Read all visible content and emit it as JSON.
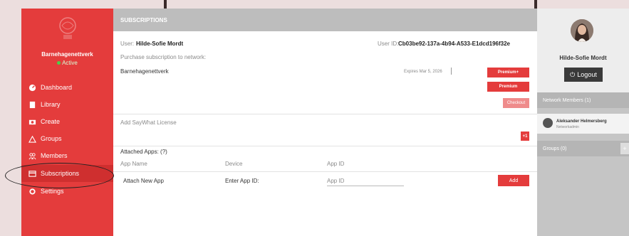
{
  "org": {
    "name": "Barnehagenettverk",
    "status": "Active"
  },
  "nav": [
    {
      "label": "Dashboard",
      "icon": "dashboard-icon"
    },
    {
      "label": "Library",
      "icon": "book-icon"
    },
    {
      "label": "Create",
      "icon": "camera-icon"
    },
    {
      "label": "Groups",
      "icon": "groups-icon"
    },
    {
      "label": "Members",
      "icon": "members-icon"
    },
    {
      "label": "Subscriptions",
      "icon": "card-icon"
    },
    {
      "label": "Settings",
      "icon": "gear-icon"
    }
  ],
  "main": {
    "header": "SUBSCRIPTIONS",
    "user_label": "User:",
    "user_name": "Hilde-Sofie Mordt",
    "user_id_label": "User ID:",
    "user_id": "Cb03be92-137a-4b94-A533-E1dcd196f32e",
    "purchase_label": "Purchase subscription to network:",
    "network_name": "Barnehagenettverk",
    "expires": "Expires Mar 5, 2026",
    "premium_plus": "Premium+",
    "premium": "Premium",
    "checkout": "Checkout",
    "license_label": "Add SayWhat License",
    "license_add": "+1",
    "attached_apps": "Attached Apps: (?)",
    "columns": [
      "App Name",
      "Device",
      "App ID"
    ],
    "attach_label": "Attach New App",
    "enter_app_id": "Enter App ID:",
    "app_id_placeholder": "App ID",
    "add_button": "Add"
  },
  "right": {
    "profile_name": "Hilde-Sofie Mordt",
    "logout": "Logout",
    "members_header": "Network Members (1)",
    "member_name": "Aleksander Helmersberg",
    "member_role": "Networkadmin",
    "groups_header": "Groups (0)",
    "plus": "+"
  },
  "colors": {
    "brand": "#e43c3c",
    "panel": "#c5c5c5",
    "header": "#bdbdbd"
  }
}
